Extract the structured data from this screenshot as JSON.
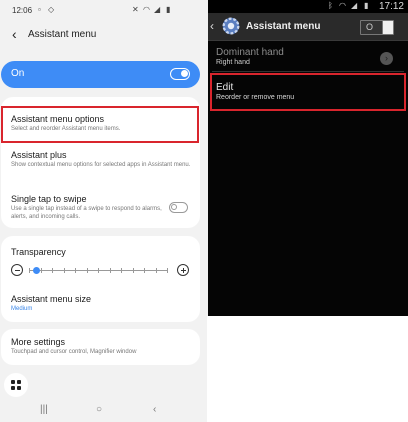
{
  "left": {
    "status": {
      "time": "12:06"
    },
    "header": {
      "title": "Assistant menu"
    },
    "master_switch": {
      "label": "On",
      "state": "on"
    },
    "items": {
      "options": {
        "title": "Assistant menu options",
        "subtitle": "Select and reorder Assistant menu items."
      },
      "plus": {
        "title": "Assistant plus",
        "subtitle": "Show contextual menu options for selected apps in Assistant menu."
      },
      "single_tap": {
        "title": "Single tap to swipe",
        "subtitle": "Use a single tap instead of a swipe to respond to alarms, alerts, and incoming calls.",
        "state": "off"
      },
      "transparency": {
        "title": "Transparency",
        "level": 0.05
      },
      "size": {
        "title": "Assistant menu size",
        "value": "Medium"
      },
      "more": {
        "title": "More settings",
        "subtitle": "Touchpad and cursor control, Magnifier window"
      }
    },
    "colors": {
      "accent": "#3e8cf6",
      "highlight": "#d9252d"
    }
  },
  "right": {
    "status": {
      "time": "17:12"
    },
    "header": {
      "title": "Assistant menu",
      "switch_label": "O"
    },
    "items": {
      "dominant": {
        "title": "Dominant hand",
        "value": "Right hand"
      },
      "edit": {
        "title": "Edit",
        "subtitle": "Reorder or remove menu"
      }
    },
    "icons": [
      "bluetooth-icon",
      "wifi-icon",
      "signal-icon",
      "battery-icon",
      "gear-icon",
      "chevron-right-icon"
    ]
  }
}
